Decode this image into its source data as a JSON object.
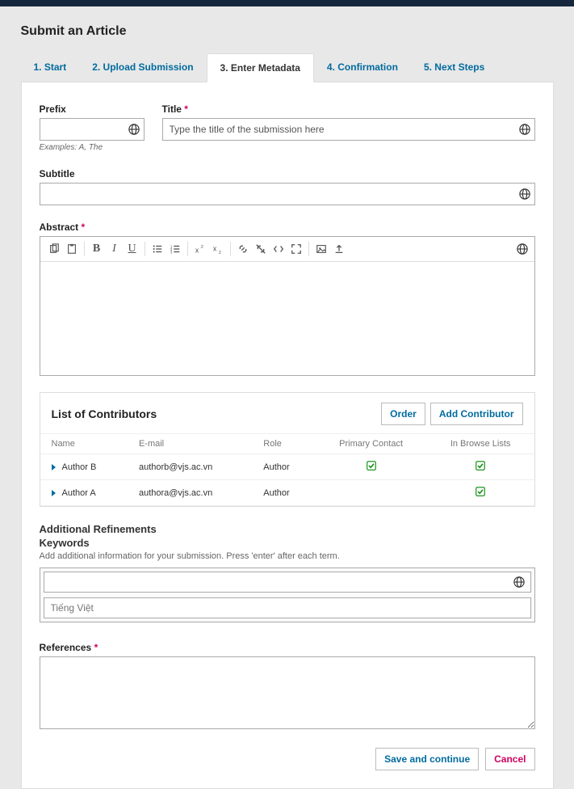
{
  "header": {
    "title": "Submit an Article"
  },
  "tabs": {
    "items": [
      {
        "label": "1. Start"
      },
      {
        "label": "2. Upload Submission"
      },
      {
        "label": "3. Enter Metadata"
      },
      {
        "label": "4. Confirmation"
      },
      {
        "label": "5. Next Steps"
      }
    ],
    "active_index": 2
  },
  "prefix": {
    "label": "Prefix",
    "value": "",
    "hint": "Examples: A, The"
  },
  "title": {
    "label": "Title",
    "placeholder": "Type the title of the submission here",
    "value": ""
  },
  "subtitle": {
    "label": "Subtitle",
    "value": ""
  },
  "abstract": {
    "label": "Abstract"
  },
  "contributors": {
    "title": "List of Contributors",
    "order_btn": "Order",
    "add_btn": "Add Contributor",
    "cols": {
      "name": "Name",
      "email": "E-mail",
      "role": "Role",
      "primary": "Primary Contact",
      "browse": "In Browse Lists"
    },
    "rows": [
      {
        "name": "Author B",
        "email": "authorb@vjs.ac.vn",
        "role": "Author",
        "primary": true,
        "browse": true
      },
      {
        "name": "Author A",
        "email": "authora@vjs.ac.vn",
        "role": "Author",
        "primary": false,
        "browse": true
      }
    ]
  },
  "refinements": {
    "title": "Additional Refinements",
    "subtitle": "Keywords",
    "hint": "Add additional information for your submission. Press 'enter' after each term.",
    "second_lang": "Tiếng Việt"
  },
  "references": {
    "label": "References",
    "value": ""
  },
  "actions": {
    "save": "Save and continue",
    "cancel": "Cancel"
  }
}
